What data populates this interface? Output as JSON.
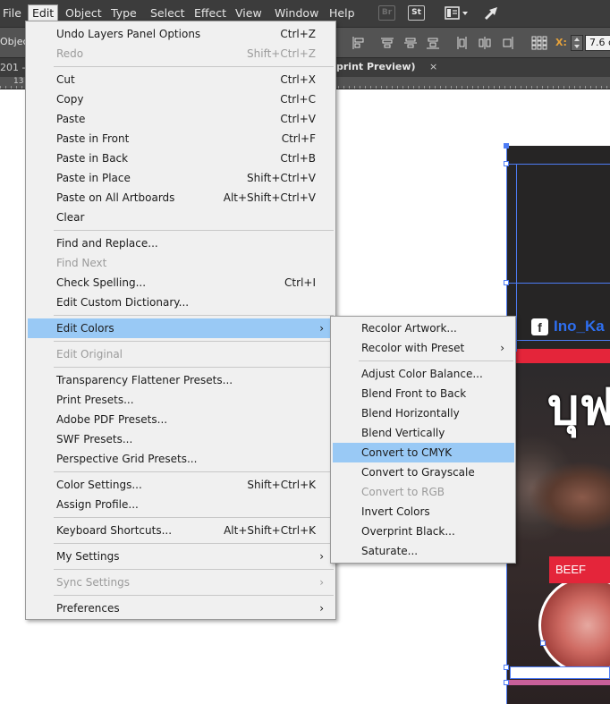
{
  "menubar": {
    "items": [
      "File",
      "Edit",
      "Object",
      "Type",
      "Select",
      "Effect",
      "View",
      "Window",
      "Help"
    ],
    "active": "Edit",
    "icons": [
      "bridge-icon",
      "stock-icon",
      "workspace-switcher-icon",
      "gpu-performance-icon"
    ],
    "bridge_label": "Br",
    "stock_label": "St"
  },
  "controlbar": {
    "left_label": "Objects",
    "x_label": "X:",
    "x_value": "7.6 c"
  },
  "tabbar": {
    "left_tab": "201 -",
    "right_tab": "print Preview)",
    "close": "×"
  },
  "ruler": {
    "numbers": [
      "13"
    ]
  },
  "edit_menu": {
    "items": [
      {
        "label": "Undo Layers Panel Options",
        "shortcut": "Ctrl+Z",
        "disabled": false
      },
      {
        "label": "Redo",
        "shortcut": "Shift+Ctrl+Z",
        "disabled": true
      },
      {
        "label": "Cut",
        "shortcut": "Ctrl+X",
        "disabled": false
      },
      {
        "label": "Copy",
        "shortcut": "Ctrl+C",
        "disabled": false
      },
      {
        "label": "Paste",
        "shortcut": "Ctrl+V",
        "disabled": false
      },
      {
        "label": "Paste in Front",
        "shortcut": "Ctrl+F",
        "disabled": false
      },
      {
        "label": "Paste in Back",
        "shortcut": "Ctrl+B",
        "disabled": false
      },
      {
        "label": "Paste in Place",
        "shortcut": "Shift+Ctrl+V",
        "disabled": false
      },
      {
        "label": "Paste on All Artboards",
        "shortcut": "Alt+Shift+Ctrl+V",
        "disabled": false
      },
      {
        "label": "Clear",
        "shortcut": "",
        "disabled": false
      },
      {
        "label": "Find and Replace...",
        "shortcut": "",
        "disabled": false
      },
      {
        "label": "Find Next",
        "shortcut": "",
        "disabled": true
      },
      {
        "label": "Check Spelling...",
        "shortcut": "Ctrl+I",
        "disabled": false
      },
      {
        "label": "Edit Custom Dictionary...",
        "shortcut": "",
        "disabled": false
      },
      {
        "label": "Edit Colors",
        "shortcut": "",
        "disabled": false,
        "submenu": true,
        "highlight": true
      },
      {
        "label": "Edit Original",
        "shortcut": "",
        "disabled": true
      },
      {
        "label": "Transparency Flattener Presets...",
        "shortcut": "",
        "disabled": false
      },
      {
        "label": "Print Presets...",
        "shortcut": "",
        "disabled": false
      },
      {
        "label": "Adobe PDF Presets...",
        "shortcut": "",
        "disabled": false
      },
      {
        "label": "SWF Presets...",
        "shortcut": "",
        "disabled": false
      },
      {
        "label": "Perspective Grid Presets...",
        "shortcut": "",
        "disabled": false
      },
      {
        "label": "Color Settings...",
        "shortcut": "Shift+Ctrl+K",
        "disabled": false
      },
      {
        "label": "Assign Profile...",
        "shortcut": "",
        "disabled": false
      },
      {
        "label": "Keyboard Shortcuts...",
        "shortcut": "Alt+Shift+Ctrl+K",
        "disabled": false
      },
      {
        "label": "My Settings",
        "shortcut": "",
        "disabled": false,
        "submenu": true
      },
      {
        "label": "Sync Settings",
        "shortcut": "",
        "disabled": true,
        "submenu": true
      },
      {
        "label": "Preferences",
        "shortcut": "",
        "disabled": false,
        "submenu": true
      }
    ]
  },
  "edit_colors_submenu": {
    "items": [
      {
        "label": "Recolor Artwork...",
        "disabled": false
      },
      {
        "label": "Recolor with Preset",
        "disabled": false,
        "submenu": true
      },
      {
        "label": "Adjust Color Balance...",
        "disabled": false
      },
      {
        "label": "Blend Front to Back",
        "disabled": false
      },
      {
        "label": "Blend Horizontally",
        "disabled": false
      },
      {
        "label": "Blend Vertically",
        "disabled": false
      },
      {
        "label": "Convert to CMYK",
        "disabled": false,
        "highlight": true
      },
      {
        "label": "Convert to Grayscale",
        "disabled": false
      },
      {
        "label": "Convert to RGB",
        "disabled": true
      },
      {
        "label": "Invert Colors",
        "disabled": false
      },
      {
        "label": "Overprint Black...",
        "disabled": false
      },
      {
        "label": "Saturate...",
        "disabled": false
      }
    ]
  },
  "artwork": {
    "facebook_text": "Ino_Ka",
    "title_text": "บุฟ",
    "badge_text": "BEEF"
  },
  "colors": {
    "menu_bg": "#f0f0f0",
    "highlight": "#99c9f5",
    "disabled_text": "#9b9b9b",
    "selection_blue": "#4d7cf5",
    "accent_red": "#e4253a",
    "ui_dark": "#3c3c3c"
  }
}
